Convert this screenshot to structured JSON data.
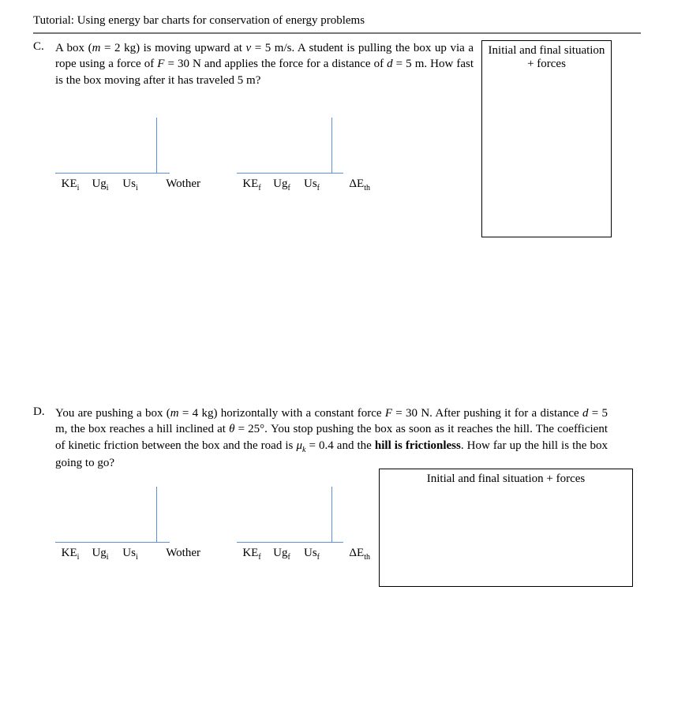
{
  "header": {
    "title": "Tutorial: Using energy bar charts for conservation of energy problems"
  },
  "problems": {
    "c": {
      "letter": "C.",
      "prompt_html": "A box (<span class='i'>m</span> = 2 kg) is moving upward at <span class='i'>v</span> = 5 m/s. A student is pulling the box up via a rope using a force of <span class='i'>F</span> = 30 N and applies the force for a distance of <span class='i'>d</span> = 5 m. How fast is the box moving after it has traveled 5 m?",
      "situation_box_line1": "Initial and final situation",
      "situation_box_line2": "+ forces"
    },
    "d": {
      "letter": "D.",
      "prompt_html": "You are pushing a box (<span class='i'>m</span> = 4 kg) horizontally with a constant force <span class='i'>F</span> = 30 N. After pushing it for a distance <span class='i'>d</span> = 5 m, the box reaches a hill inclined at <span class='i'>θ</span> = 25°. You stop pushing the box as soon as it reaches the hill. The coefficient of kinetic friction between the box and the road is <span class='i'>μ</span><span class='sub i'>k</span> = 0.4 and the <b>hill is frictionless</b>. How far up the hill is the box going to go?",
      "situation_box_line1": "Initial and final situation + forces"
    }
  },
  "chart_data": [
    {
      "id": "c-initial",
      "type": "bar",
      "role": "initial-energy-bar-chart",
      "categories": [
        "KE_i",
        "Ug_i",
        "Us_i",
        "W_other"
      ],
      "values": [
        null,
        null,
        null,
        null
      ],
      "title": "",
      "xlabel": "",
      "ylabel": "",
      "ylim": null
    },
    {
      "id": "c-final",
      "type": "bar",
      "role": "final-energy-bar-chart",
      "categories": [
        "KE_f",
        "Ug_f",
        "Us_f",
        "ΔE_th"
      ],
      "values": [
        null,
        null,
        null,
        null
      ],
      "title": "",
      "xlabel": "",
      "ylabel": "",
      "ylim": null
    },
    {
      "id": "d-initial",
      "type": "bar",
      "role": "initial-energy-bar-chart",
      "categories": [
        "KE_i",
        "Ug_i",
        "Us_i",
        "W_other"
      ],
      "values": [
        null,
        null,
        null,
        null
      ],
      "title": "",
      "xlabel": "",
      "ylabel": "",
      "ylim": null
    },
    {
      "id": "d-final",
      "type": "bar",
      "role": "final-energy-bar-chart",
      "categories": [
        "KE_f",
        "Ug_f",
        "Us_f",
        "ΔE_th"
      ],
      "values": [
        null,
        null,
        null,
        null
      ],
      "title": "",
      "xlabel": "",
      "ylabel": "",
      "ylim": null
    }
  ],
  "labels": {
    "initial": {
      "ke": "KE<span class='sub'>i</span>",
      "ug": "Ug<span class='sub'>i</span>",
      "us": "Us<span class='sub'>i</span>",
      "w": "Wother"
    },
    "final": {
      "ke": "KE<span class='sub'>f</span>",
      "ug": "Ug<span class='sub'>f</span>",
      "us": "Us<span class='sub'>f</span>",
      "de": "ΔE<span class='sub'>th</span>"
    }
  }
}
